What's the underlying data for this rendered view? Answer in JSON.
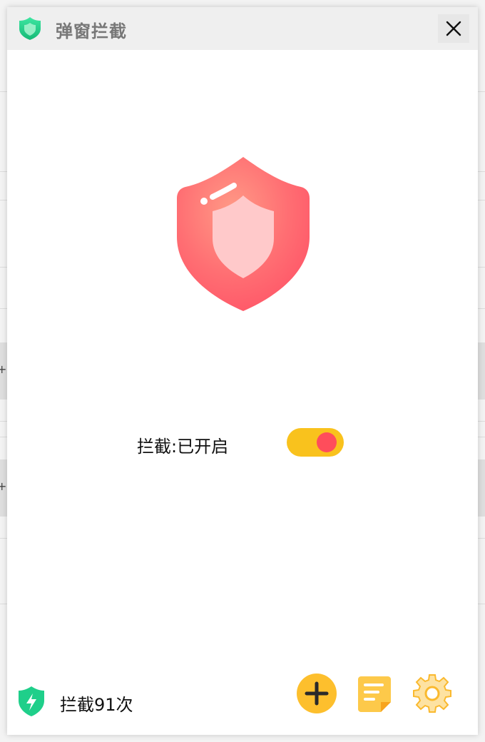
{
  "window": {
    "title": "弹窗拦截",
    "close_icon": "close-icon",
    "title_icon": "shield-icon"
  },
  "status": {
    "label": "拦截:已开启",
    "toggle_on": true,
    "hero_icon": "shield-icon"
  },
  "footer": {
    "count_label": "拦截91次",
    "count_icon": "lightning-shield-icon",
    "buttons": [
      {
        "name": "add-button",
        "icon": "plus-icon"
      },
      {
        "name": "log-button",
        "icon": "document-icon"
      },
      {
        "name": "settings-button",
        "icon": "gear-icon"
      }
    ]
  },
  "colors": {
    "accent_green": "#1fcf8a",
    "shield_red": "#ff5d6c",
    "toggle_track": "#f9c21d",
    "toggle_knob": "#ff4d5b",
    "button_yellow": "#fdbf2d"
  }
}
